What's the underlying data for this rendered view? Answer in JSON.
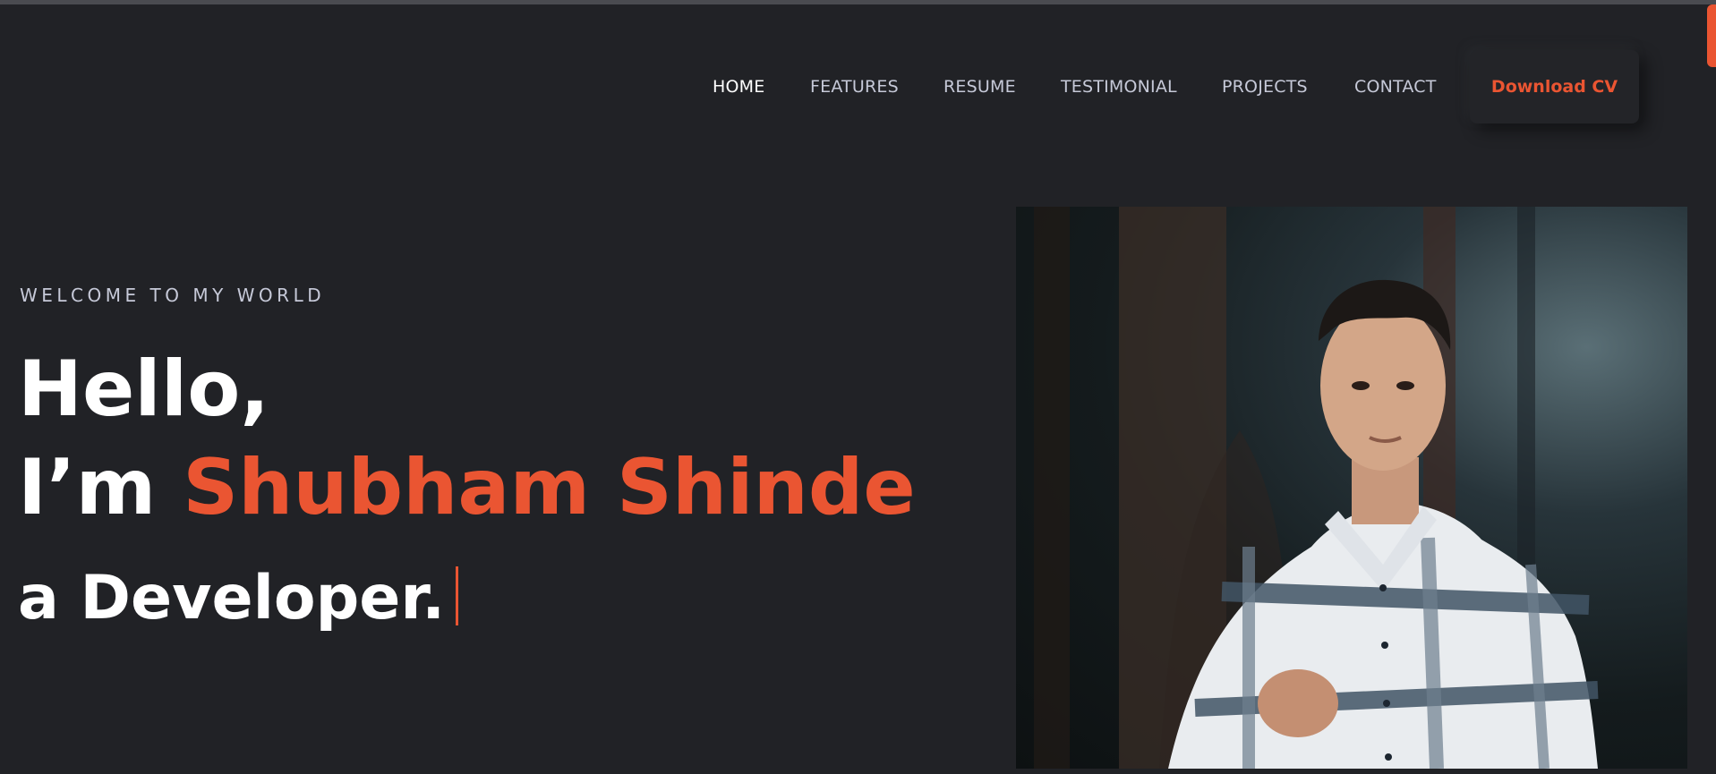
{
  "nav": {
    "items": [
      {
        "label": "HOME",
        "active": true
      },
      {
        "label": "FEATURES",
        "active": false
      },
      {
        "label": "RESUME",
        "active": false
      },
      {
        "label": "TESTIMONIAL",
        "active": false
      },
      {
        "label": "PROJECTS",
        "active": false
      },
      {
        "label": "CONTACT",
        "active": false
      }
    ],
    "cta_label": "Download CV"
  },
  "hero": {
    "eyebrow": "WELCOME TO MY WORLD",
    "greeting": "Hello,",
    "intro": "I’m",
    "name": "Shubham Shinde",
    "role": "a Developer."
  },
  "colors": {
    "background": "#212226",
    "accent": "#ea5532",
    "text": "#c6c9d8"
  }
}
